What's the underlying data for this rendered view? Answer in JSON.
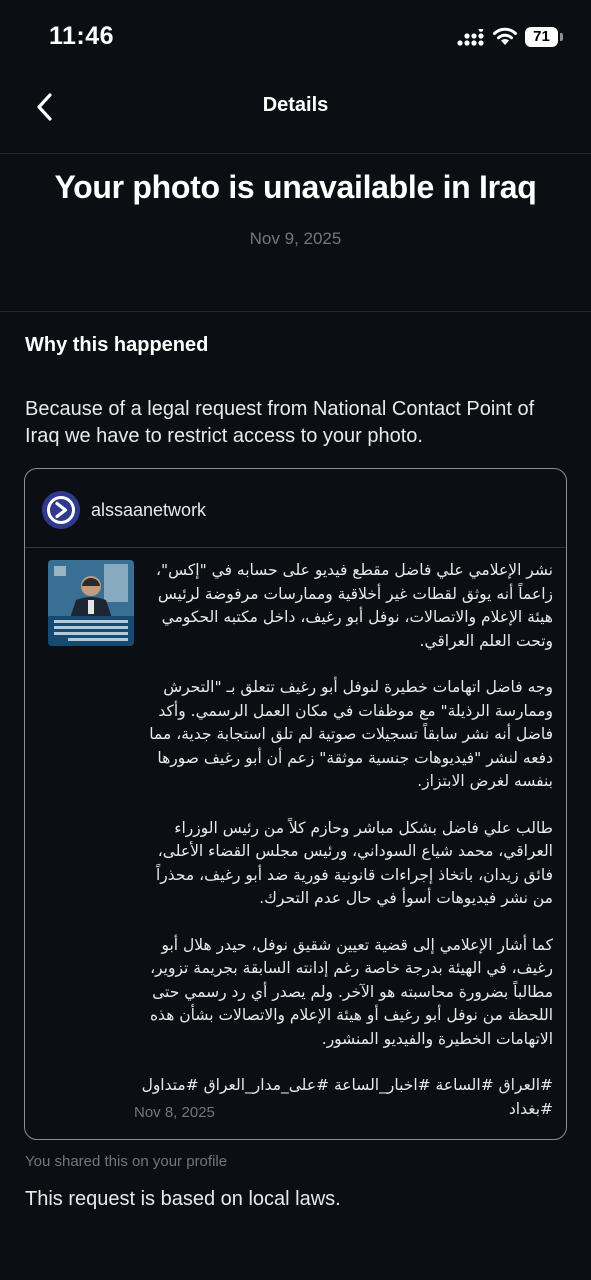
{
  "status_bar": {
    "time": "11:46",
    "battery": "71",
    "icons": [
      "cellular-signal-icon",
      "wifi-icon",
      "battery-icon"
    ]
  },
  "nav": {
    "back_icon": "chevron-left-icon",
    "title": "Details"
  },
  "notice": {
    "headline": "Your photo is unavailable in Iraq",
    "date": "Nov 9, 2025"
  },
  "reason": {
    "title": "Why this happened",
    "text": "Because of a legal request from National Contact Point of Iraq we have to restrict access to your photo."
  },
  "post": {
    "avatar_icon": "alssaanetwork-logo",
    "username": "alssaanetwork",
    "paragraphs": [
      "نشر الإعلامي علي فاضل مقطع فيديو على حسابه في \"إكس\"، زاعماً أنه يوثق لقطات غير أخلاقية وممارسات مرفوضة لرئيس هيئة الإعلام والاتصالات، نوفل أبو رغيف، داخل مكتبه الحكومي وتحت العلم العراقي.",
      "وجه فاضل اتهامات خطيرة لنوفل أبو رغيف تتعلق بـ \"التحرش وممارسة الرذيلة\" مع موظفات في مكان العمل الرسمي. وأكد فاضل أنه نشر سابقاً تسجيلات صوتية لم تلق استجابة جدية، مما دفعه لنشر \"فيديوهات جنسية موثقة\" زعم أن أبو رغيف صورها بنفسه لغرض الابتزاز.",
      "طالب علي فاضل بشكل مباشر وحازم كلاً من رئيس الوزراء العراقي، محمد شياع السوداني، ورئيس مجلس القضاء الأعلى، فائق زيدان، باتخاذ إجراءات قانونية فورية ضد أبو رغيف، محذراً من نشر فيديوهات أسوأ في حال عدم التحرك.",
      "كما أشار الإعلامي إلى قضية تعيين شقيق نوفل، حيدر هلال أبو رغيف، في الهيئة بدرجة خاصة رغم إدانته السابقة بجريمة تزوير، مطالباً بضرورة محاسبته هو الآخر. ولم يصدر أي رد رسمي حتى اللحظة من نوفل أبو رغيف أو هيئة الإعلام والاتصالات بشأن هذه الاتهامات الخطيرة والفيديو المنشور."
    ],
    "hashtags": "#العراق #الساعة #اخبار_الساعة #على_مدار_العراق #متداول #بغداد",
    "date": "Nov 8, 2025"
  },
  "footer": {
    "shared_note": "You shared this on your profile",
    "local_laws": "This request is based on local laws."
  },
  "colors": {
    "background": "#0b0f14",
    "text_primary": "#e7e9ea",
    "text_secondary": "#71767b",
    "card_border": "#8b8f94",
    "avatar_bg": "#2d3a8c"
  }
}
